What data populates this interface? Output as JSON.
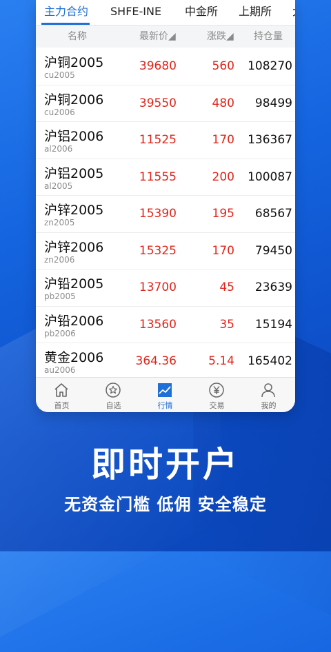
{
  "tabs": [
    {
      "label": "主力合约"
    },
    {
      "label": "SHFE-INE"
    },
    {
      "label": "中金所"
    },
    {
      "label": "上期所"
    },
    {
      "label": "大"
    }
  ],
  "header": {
    "name": "名称",
    "price": "最新价◢",
    "change": "涨跌◢",
    "oi": "持仓量◀▶"
  },
  "rows": [
    {
      "name": "沪铜2005",
      "code": "cu2005",
      "price": "39680",
      "change": "560",
      "oi": "108270"
    },
    {
      "name": "沪铜2006",
      "code": "cu2006",
      "price": "39550",
      "change": "480",
      "oi": "98499"
    },
    {
      "name": "沪铝2006",
      "code": "al2006",
      "price": "11525",
      "change": "170",
      "oi": "136367"
    },
    {
      "name": "沪铝2005",
      "code": "al2005",
      "price": "11555",
      "change": "200",
      "oi": "100087"
    },
    {
      "name": "沪锌2005",
      "code": "zn2005",
      "price": "15390",
      "change": "195",
      "oi": "68567"
    },
    {
      "name": "沪锌2006",
      "code": "zn2006",
      "price": "15325",
      "change": "170",
      "oi": "79450"
    },
    {
      "name": "沪铅2005",
      "code": "pb2005",
      "price": "13700",
      "change": "45",
      "oi": "23639"
    },
    {
      "name": "沪铅2006",
      "code": "pb2006",
      "price": "13560",
      "change": "35",
      "oi": "15194"
    },
    {
      "name": "黄金2006",
      "code": "au2006",
      "price": "364.36",
      "change": "5.14",
      "oi": "165402"
    }
  ],
  "nav": [
    {
      "label": "首页",
      "icon": "home-icon"
    },
    {
      "label": "自选",
      "icon": "star-icon"
    },
    {
      "label": "行情",
      "icon": "chart-icon"
    },
    {
      "label": "交易",
      "icon": "yen-icon"
    },
    {
      "label": "我的",
      "icon": "user-icon"
    }
  ],
  "promo": {
    "headline": "即时开户",
    "subline": "无资金门槛 低佣 安全稳定"
  },
  "colors": {
    "accent": "#1f6fd6",
    "up": "#e1251b",
    "background": "#1565e0"
  }
}
